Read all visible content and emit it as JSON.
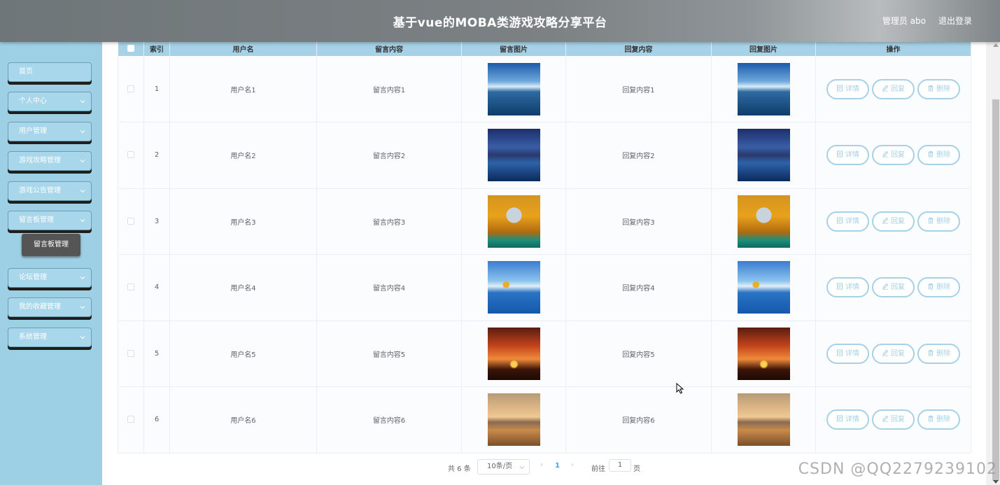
{
  "header": {
    "title": "基于vue的MOBA类游戏攻略分享平台",
    "user": "管理员 abo",
    "logout": "退出登录"
  },
  "sidebar": {
    "items": [
      {
        "label": "首页",
        "has_children": false
      },
      {
        "label": "个人中心",
        "has_children": true
      },
      {
        "label": "用户管理",
        "has_children": true
      },
      {
        "label": "游戏攻略管理",
        "has_children": true
      },
      {
        "label": "游戏公告管理",
        "has_children": true
      },
      {
        "label": "留言板管理",
        "has_children": true
      },
      {
        "label": "论坛管理",
        "has_children": true
      },
      {
        "label": "我的收藏管理",
        "has_children": true
      },
      {
        "label": "系统管理",
        "has_children": true
      }
    ],
    "active_submenu": "留言板管理"
  },
  "table": {
    "columns": [
      "索引",
      "用户名",
      "留言内容",
      "留言图片",
      "回复内容",
      "回复图片",
      "操作"
    ],
    "rows": [
      {
        "index": "1",
        "username": "用户名1",
        "content": "留言内容1",
        "reply": "回复内容1"
      },
      {
        "index": "2",
        "username": "用户名2",
        "content": "留言内容2",
        "reply": "回复内容2"
      },
      {
        "index": "3",
        "username": "用户名3",
        "content": "留言内容3",
        "reply": "回复内容3"
      },
      {
        "index": "4",
        "username": "用户名4",
        "content": "留言内容4",
        "reply": "回复内容4"
      },
      {
        "index": "5",
        "username": "用户名5",
        "content": "留言内容5",
        "reply": "回复内容5"
      },
      {
        "index": "6",
        "username": "用户名6",
        "content": "留言内容6",
        "reply": "回复内容6"
      }
    ],
    "actions": {
      "detail": "详情",
      "reply": "回复",
      "delete": "删除"
    }
  },
  "pagination": {
    "total": "共 6 条",
    "page_size": "10条/页",
    "current_page": "1",
    "goto_label": "前往",
    "goto_value": "1",
    "goto_unit": "页"
  },
  "watermark": "CSDN @QQ2279239102",
  "colors": {
    "accent": "#a6d1e6",
    "sidebar_bg": "#9ed0e5",
    "submenu_bg": "#555555"
  }
}
